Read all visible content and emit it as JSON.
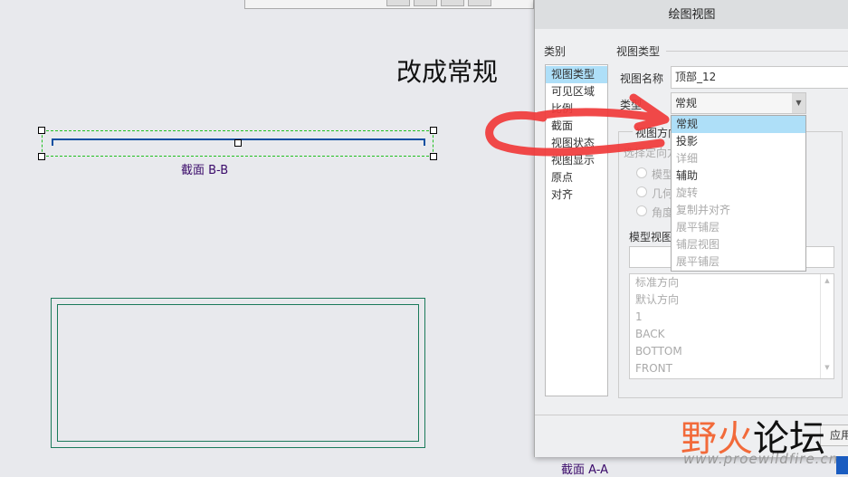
{
  "annotation": "改成常规",
  "drawing": {
    "section_bb": "截面 B-B",
    "section_aa": "截面 A-A"
  },
  "dialog": {
    "title": "绘图视图",
    "category_label": "类别",
    "categories": [
      {
        "label": "视图类型",
        "selected": true
      },
      {
        "label": "可见区域"
      },
      {
        "label": "比例"
      },
      {
        "label": "截面"
      },
      {
        "label": "视图状态"
      },
      {
        "label": "视图显示"
      },
      {
        "label": "原点"
      },
      {
        "label": "对齐"
      }
    ],
    "section_title": "视图类型",
    "view_name_label": "视图名称",
    "view_name_value": "顶部_12",
    "type_label": "类型",
    "type_value": "常规",
    "type_options": [
      {
        "label": "常规",
        "selected": true
      },
      {
        "label": "投影"
      },
      {
        "label": "详细",
        "disabled": true
      },
      {
        "label": "辅助"
      },
      {
        "label": "旋转",
        "disabled": true
      },
      {
        "label": "复制并对齐",
        "disabled": true
      },
      {
        "label": "展平铺层",
        "disabled": true
      },
      {
        "label": "铺层视图",
        "disabled": true
      },
      {
        "label": "展平铺层",
        "disabled": true
      }
    ],
    "orientation_group": "视图方向",
    "orientation_sub": "选择定向方法",
    "radios": [
      "模型视图名",
      "几何参考",
      "角度"
    ],
    "model_view_label": "模型视图名",
    "model_views": [
      "标准方向",
      "默认方向",
      "1",
      "BACK",
      "BOTTOM",
      "FRONT"
    ],
    "apply_label": "应用"
  },
  "watermark": {
    "text": "野火论坛",
    "url": "www.proewildfire.cn"
  },
  "colors": {
    "accent": "#aedff8",
    "annotation_arrow": "#f03a3a",
    "section_box": "#20c020",
    "edge_line": "#0a4fa0"
  }
}
